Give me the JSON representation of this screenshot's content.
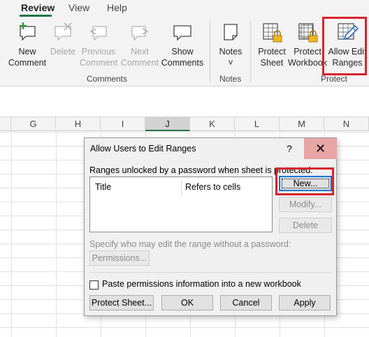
{
  "tabs": [
    {
      "label": "Review",
      "active": true
    },
    {
      "label": "View",
      "active": false
    },
    {
      "label": "Help",
      "active": false
    }
  ],
  "ribbon": {
    "comments_group": {
      "label": "Comments",
      "buttons": [
        {
          "line1": "New",
          "line2": "Comment",
          "icon": "new-comment-icon",
          "enabled": true
        },
        {
          "line1": "Delete",
          "line2": "",
          "icon": "delete-comment-icon",
          "enabled": false
        },
        {
          "line1": "Previous",
          "line2": "Comment",
          "icon": "previous-comment-icon",
          "enabled": false
        },
        {
          "line1": "Next",
          "line2": "Comment",
          "icon": "next-comment-icon",
          "enabled": false
        },
        {
          "line1": "Show",
          "line2": "Comments",
          "icon": "show-comments-icon",
          "enabled": true
        }
      ]
    },
    "notes_group": {
      "label": "Notes",
      "button": {
        "line1": "Notes",
        "line2": "˅",
        "icon": "notes-icon"
      }
    },
    "protect_group": {
      "label": "Protect",
      "buttons": [
        {
          "line1": "Protect",
          "line2": "Sheet",
          "icon": "protect-sheet-icon"
        },
        {
          "line1": "Protect",
          "line2": "Workbook",
          "icon": "protect-workbook-icon"
        },
        {
          "line1": "Allow Edit",
          "line2": "Ranges",
          "icon": "allow-edit-ranges-icon"
        }
      ]
    }
  },
  "sheet": {
    "columns": [
      "G",
      "H",
      "I",
      "J",
      "K",
      "L",
      "M",
      "N"
    ],
    "selected_column": "J"
  },
  "dialog": {
    "title": "Allow Users to Edit Ranges",
    "help_label": "?",
    "close_label": "✕",
    "ranges_label": "Ranges unlocked by a password when sheet is protected:",
    "list_headers": {
      "title": "Title",
      "refers": "Refers to cells"
    },
    "buttons": {
      "new": "New...",
      "modify": "Modify...",
      "delete": "Delete",
      "permissions": "Permissions...",
      "protect_sheet": "Protect Sheet...",
      "ok": "OK",
      "cancel": "Cancel",
      "apply": "Apply"
    },
    "specify_label": "Specify who may edit the range without a password:",
    "paste_label": "Paste permissions information into a new workbook",
    "paste_checked": false
  },
  "colors": {
    "accent": "#217346",
    "highlight": "#d9232d",
    "default_button": "#0078d7"
  }
}
